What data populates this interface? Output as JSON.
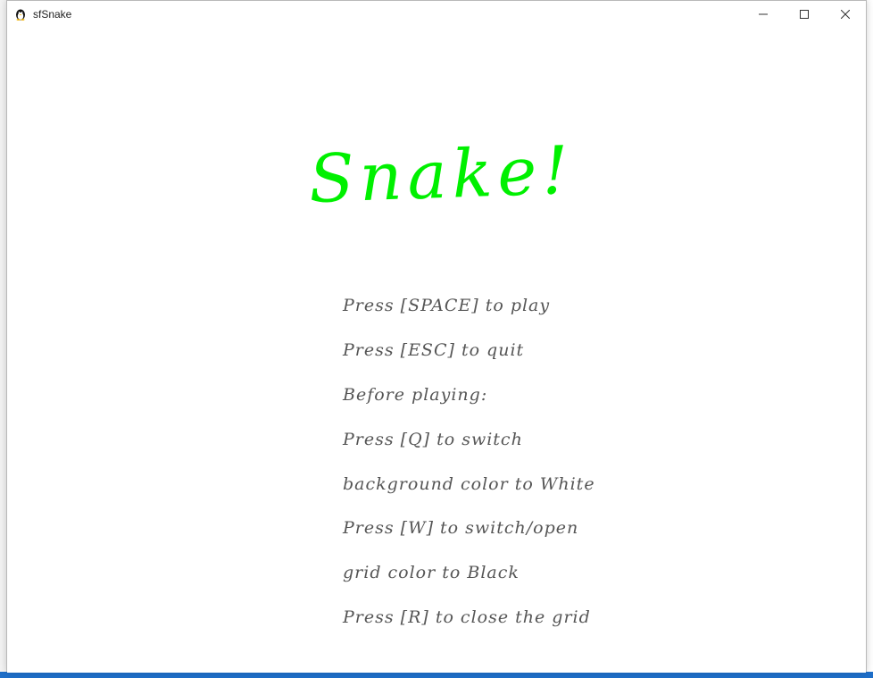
{
  "window": {
    "title": "sfSnake"
  },
  "game": {
    "title": "Snake!",
    "title_color": "#00f000",
    "text_color": "#555555",
    "lines": [
      "Press [SPACE] to play",
      "Press [ESC] to quit",
      "Before playing:",
      "Press [Q] to switch",
      "background color to White",
      "Press [W] to switch/open",
      "grid color to Black",
      "Press [R] to close the grid"
    ]
  },
  "icons": {
    "app": "penguin-icon",
    "minimize": "minimize-icon",
    "maximize": "maximize-icon",
    "close": "close-icon"
  }
}
